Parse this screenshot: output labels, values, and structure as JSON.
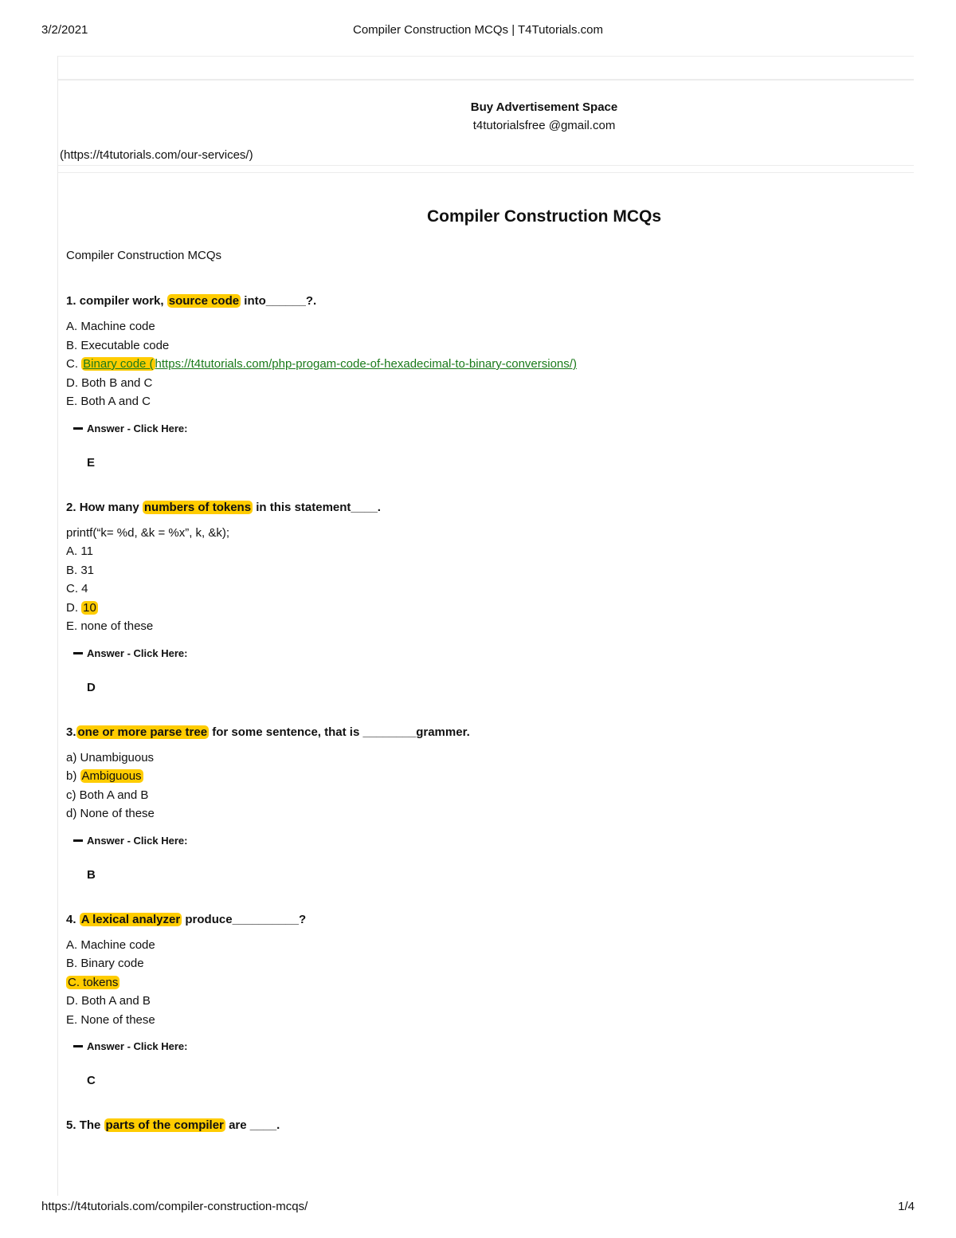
{
  "print_header": {
    "date": "3/2/2021",
    "page_title": "Compiler Construction MCQs | T4Tutorials.com"
  },
  "print_footer": {
    "url": "https://t4tutorials.com/compiler-construction-mcqs/",
    "page_number": "1/4"
  },
  "ad": {
    "title": "Buy Advertisement Space",
    "email": "t4tutorialsfree @gmail.com",
    "link": "(https://t4tutorials.com/our-services/)"
  },
  "article": {
    "title": "Compiler Construction MCQs",
    "subtitle": "Compiler Construction MCQs"
  },
  "answer_toggle_label": "Answer - Click Here:",
  "highlight_color": "#ffcc00",
  "link_color": "#1a7a1a",
  "questions": [
    {
      "number": "1.",
      "pre": "compiler work,",
      "highlight": "source code",
      "post": "into______?.",
      "options": [
        {
          "text": "A. Machine code"
        },
        {
          "prefix": "C. ",
          "link_text": "Binary code (",
          "link_url": "https://t4tutorials.com/php-progam-code-of-hexadecimal-to-binary-conversions/)",
          "id": "C"
        },
        {
          "text": "B. Executable code"
        },
        {
          "text": "D. Both B and C"
        },
        {
          "text": "E. Both A and C"
        }
      ],
      "answer": "E"
    },
    {
      "number": "2.",
      "pre": "How many",
      "highlight": "numbers of tokens",
      "post": "in this statement____.",
      "code": "printf(“k= %d, &k = %x”, k, &k);",
      "options": [
        {
          "text": "A. 11"
        },
        {
          "text": "B. 31"
        },
        {
          "text": "C. 4"
        },
        {
          "prefix": "D. ",
          "highlight": "10"
        },
        {
          "text": "E. none of these"
        }
      ],
      "answer": "D"
    },
    {
      "number": "3.",
      "pre": "",
      "highlight": "one or more parse tree",
      "post": "for some sentence, that is ________grammer.",
      "options": [
        {
          "text": "a) Unambiguous"
        },
        {
          "prefix": "b) ",
          "highlight": "Ambiguous"
        },
        {
          "text": "c) Both A and B"
        },
        {
          "text": "d) None of these"
        }
      ],
      "answer": "B"
    },
    {
      "number": "4.",
      "pre": "",
      "highlight": "A lexical analyzer",
      "post": "produce__________?",
      "options": [
        {
          "text": "A. Machine code"
        },
        {
          "text": "B. Binary code"
        },
        {
          "highlight": "C. tokens"
        },
        {
          "text": "D. Both A and B"
        },
        {
          "text": "E. None of these"
        }
      ],
      "answer": "C"
    },
    {
      "number": "5.",
      "pre": "The",
      "highlight": "parts of the compiler",
      "post": "are ____."
    }
  ]
}
